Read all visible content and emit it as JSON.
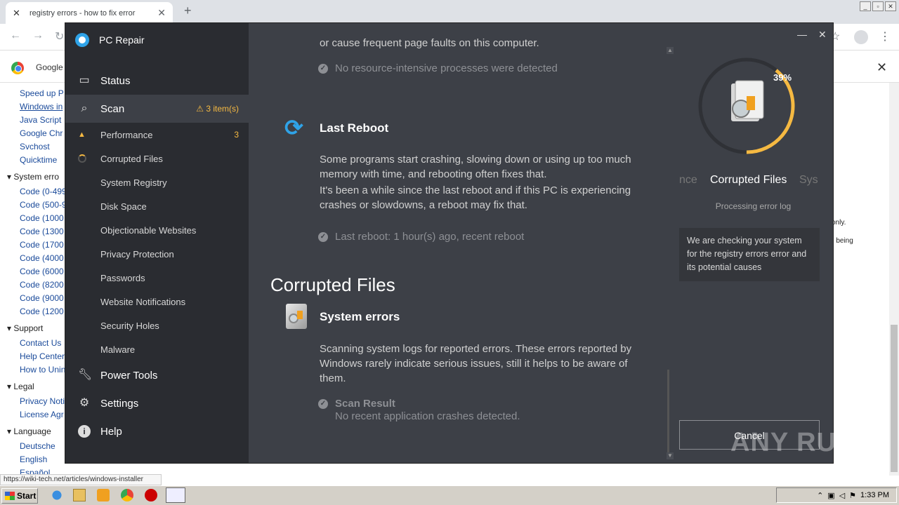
{
  "browser": {
    "tab_title": "registry errors - how to fix error",
    "tab_close": "✕",
    "new_tab": "+",
    "bookmark": "Google",
    "status_url": "https://wiki-tech.net/articles/windows-installer"
  },
  "page": {
    "links_top": [
      "Speed up P",
      "Windows in",
      "Java Script",
      "Google Chr",
      "Svchost",
      "Quicktime"
    ],
    "section_system": "System erro",
    "codes": [
      "Code (0-499",
      "Code (500-9",
      "Code (1000",
      "Code (1300",
      "Code (1700",
      "Code (4000",
      "Code (6000",
      "Code (8200",
      "Code (9000",
      "Code (1200"
    ],
    "section_support": "Support",
    "support_links": [
      "Contact Us",
      "Help Center",
      "How to Unin"
    ],
    "section_legal": "Legal",
    "legal_links": [
      "Privacy Noti",
      "License Agr"
    ],
    "section_language": "Language",
    "language_links": [
      "Deutsche",
      "English",
      "Español"
    ],
    "right_frag1": "only.",
    "right_frag2": "n being"
  },
  "app": {
    "title": "PC Repair",
    "nav": {
      "status": "Status",
      "scan": "Scan",
      "scan_badge": "⚠ 3 item(s)",
      "power_tools": "Power Tools",
      "settings": "Settings",
      "help": "Help"
    },
    "scan_items": [
      {
        "label": "Performance",
        "count": "3"
      },
      {
        "label": "Corrupted Files"
      },
      {
        "label": "System Registry"
      },
      {
        "label": "Disk Space"
      },
      {
        "label": "Objectionable Websites"
      },
      {
        "label": "Privacy Protection"
      },
      {
        "label": "Passwords"
      },
      {
        "label": "Website Notifications"
      },
      {
        "label": "Security Holes"
      },
      {
        "label": "Malware"
      }
    ],
    "content": {
      "top_partial": "or cause frequent page faults on this computer.",
      "no_resource": "No resource-intensive processes were detected",
      "last_reboot_title": "Last Reboot",
      "last_reboot_p1a": "Some programs start crashing, slowing down or using up too much",
      "last_reboot_p1b": "memory with time, and rebooting often fixes that.",
      "last_reboot_p2a": "It's been a while since the last reboot and if this PC is experiencing",
      "last_reboot_p2b": "crashes or slowdowns, a reboot may fix that.",
      "last_reboot_result": "Last reboot: 1 hour(s) ago, recent reboot",
      "section_title": "Corrupted Files",
      "sys_errors_title": "System errors",
      "sys_p1": "Scanning system logs for reported errors. These errors reported by",
      "sys_p2": "Windows rarely indicate serious issues, still it helps to be aware of",
      "sys_p3": "them.",
      "scan_result_label": "Scan Result",
      "scan_result_value": "No recent application crashes detected."
    },
    "progress": {
      "percent_text": "39%",
      "percent_value": 0.39,
      "carousel_prev": "nce",
      "carousel_current": "Corrupted Files",
      "carousel_next": "Sys",
      "status": "Processing error log",
      "note": "We are checking your system for the registry errors error and its potential causes",
      "cancel": "Cancel"
    },
    "colors": {
      "accent": "#f5b942",
      "sidebar": "#2a2c31",
      "panel": "#3d4047",
      "brand": "#2fa3e8"
    }
  },
  "taskbar": {
    "start": "Start",
    "clock": "1:33 PM"
  },
  "watermark": "ANY RUN"
}
